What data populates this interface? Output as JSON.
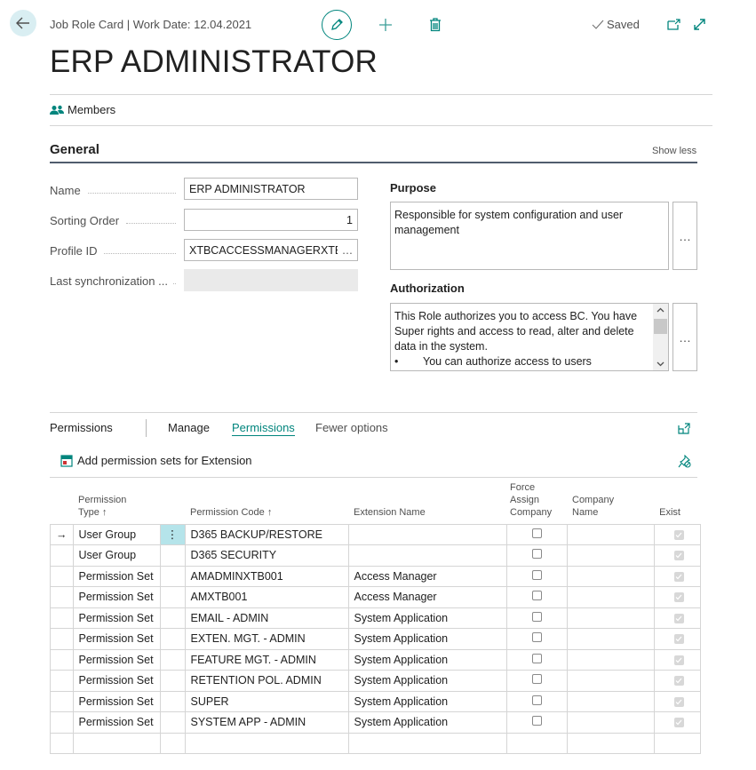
{
  "header": {
    "breadcrumb": "Job Role Card | Work Date: 12.04.2021",
    "title": "ERP ADMINISTRATOR",
    "saved_label": "Saved",
    "icons": {
      "back": "arrow-left-icon",
      "edit": "pencil-icon",
      "new": "plus-icon",
      "delete": "trash-icon",
      "saved": "checkmark-icon",
      "open_new_window": "open-in-new-window-icon",
      "expand": "expand-icon"
    }
  },
  "action_bar": {
    "members_label": "Members"
  },
  "general": {
    "section_title": "General",
    "show_less_label": "Show less",
    "fields": [
      {
        "label": "Name",
        "value": "ERP ADMINISTRATOR"
      },
      {
        "label": "Sorting Order",
        "value": "1"
      },
      {
        "label": "Profile ID",
        "value": "XTBCACCESSMANAGERXTBC"
      },
      {
        "label": "Last synchronization ...",
        "value": ""
      }
    ],
    "purpose": {
      "label": "Purpose",
      "value": "Responsible for system configuration and user management"
    },
    "authorization": {
      "label": "Authorization",
      "line1": "This Role authorizes you to access BC. You have Super rights and access to read, alter and delete data in the system.",
      "line2_bullet": "•",
      "line2": "You can authorize access to users"
    },
    "ellipsis": "…"
  },
  "permissions_part": {
    "caption": "Permissions",
    "tabs": [
      {
        "label": "Manage",
        "active": false
      },
      {
        "label": "Permissions",
        "active": true
      },
      {
        "label": "Fewer options",
        "active": false
      }
    ],
    "action_label": "Add permission sets for Extension",
    "accent_color": "#00857d",
    "columns": [
      {
        "label": "Permission Type",
        "sort": "ascending"
      },
      {
        "label": "Permission Code",
        "sort": "ascending"
      },
      {
        "label": "Extension Name"
      },
      {
        "label": "Force Assign Company"
      },
      {
        "label": "Company Name"
      },
      {
        "label": "Exist"
      }
    ],
    "col_labels": {
      "type_line1": "Permission",
      "type_line2": "Type",
      "code": "Permission Code",
      "ext": "Extension Name",
      "force_line1": "Force",
      "force_line2": "Assign",
      "force_line3": "Company",
      "company_line1": "Company",
      "company_line2": "Name",
      "exist": "Exist",
      "sort_arrow": "↑"
    },
    "rows": [
      {
        "type": "User Group",
        "code": "D365 BACKUP/RESTORE",
        "extension": "",
        "force_assign": false,
        "company": "",
        "exist": true,
        "selected": true
      },
      {
        "type": "User Group",
        "code": "D365 SECURITY",
        "extension": "",
        "force_assign": false,
        "company": "",
        "exist": true
      },
      {
        "type": "Permission Set",
        "code": "AMADMINXTB001",
        "extension": "Access Manager",
        "force_assign": false,
        "company": "",
        "exist": true
      },
      {
        "type": "Permission Set",
        "code": "AMXTB001",
        "extension": "Access Manager",
        "force_assign": false,
        "company": "",
        "exist": true
      },
      {
        "type": "Permission Set",
        "code": "EMAIL - ADMIN",
        "extension": "System Application",
        "force_assign": false,
        "company": "",
        "exist": true
      },
      {
        "type": "Permission Set",
        "code": "EXTEN. MGT. - ADMIN",
        "extension": "System Application",
        "force_assign": false,
        "company": "",
        "exist": true
      },
      {
        "type": "Permission Set",
        "code": "FEATURE MGT. - ADMIN",
        "extension": "System Application",
        "force_assign": false,
        "company": "",
        "exist": true
      },
      {
        "type": "Permission Set",
        "code": "RETENTION POL. ADMIN",
        "extension": "System Application",
        "force_assign": false,
        "company": "",
        "exist": true
      },
      {
        "type": "Permission Set",
        "code": "SUPER",
        "extension": "System Application",
        "force_assign": false,
        "company": "",
        "exist": true
      },
      {
        "type": "Permission Set",
        "code": "SYSTEM APP - ADMIN",
        "extension": "System Application",
        "force_assign": false,
        "company": "",
        "exist": true
      }
    ],
    "row_indicator": "→",
    "row_menu": "⋮"
  }
}
